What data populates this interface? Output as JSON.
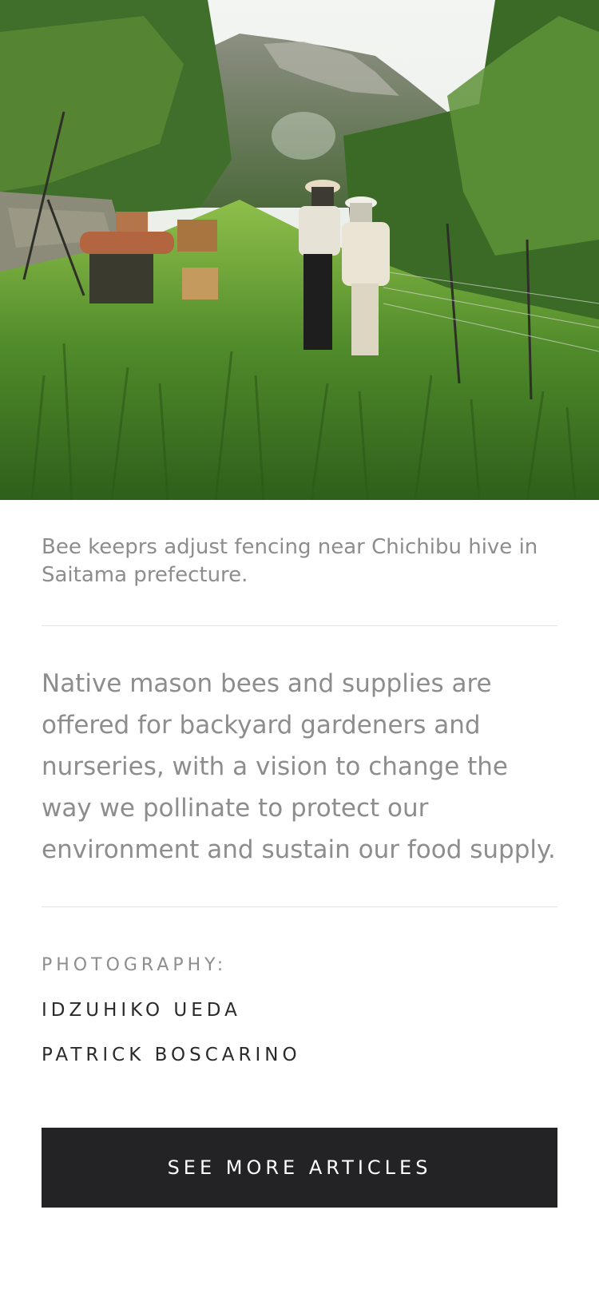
{
  "hero": {
    "alt": "Beekeepers in protective suits standing among beehives on a grassy mountain slope"
  },
  "caption": "Bee keeprs adjust fencing near Chichibu hive in Saitama prefecture.",
  "body_text": "Native mason bees and supplies are offered for backyard gardeners and nurseries, with a vision to change the way we pollinate to protect our environment and sustain our food supply.",
  "credits": {
    "label": "PHOTOGRAPHY:",
    "names": [
      "IDZUHIKO UEDA",
      "PATRICK BOSCARINO"
    ]
  },
  "cta": {
    "label": "SEE MORE ARTICLES"
  },
  "colors": {
    "muted_text": "#8d8d8d",
    "dark_text": "#2a2a2a",
    "button_bg": "#232325",
    "divider": "#e3e3e3"
  }
}
